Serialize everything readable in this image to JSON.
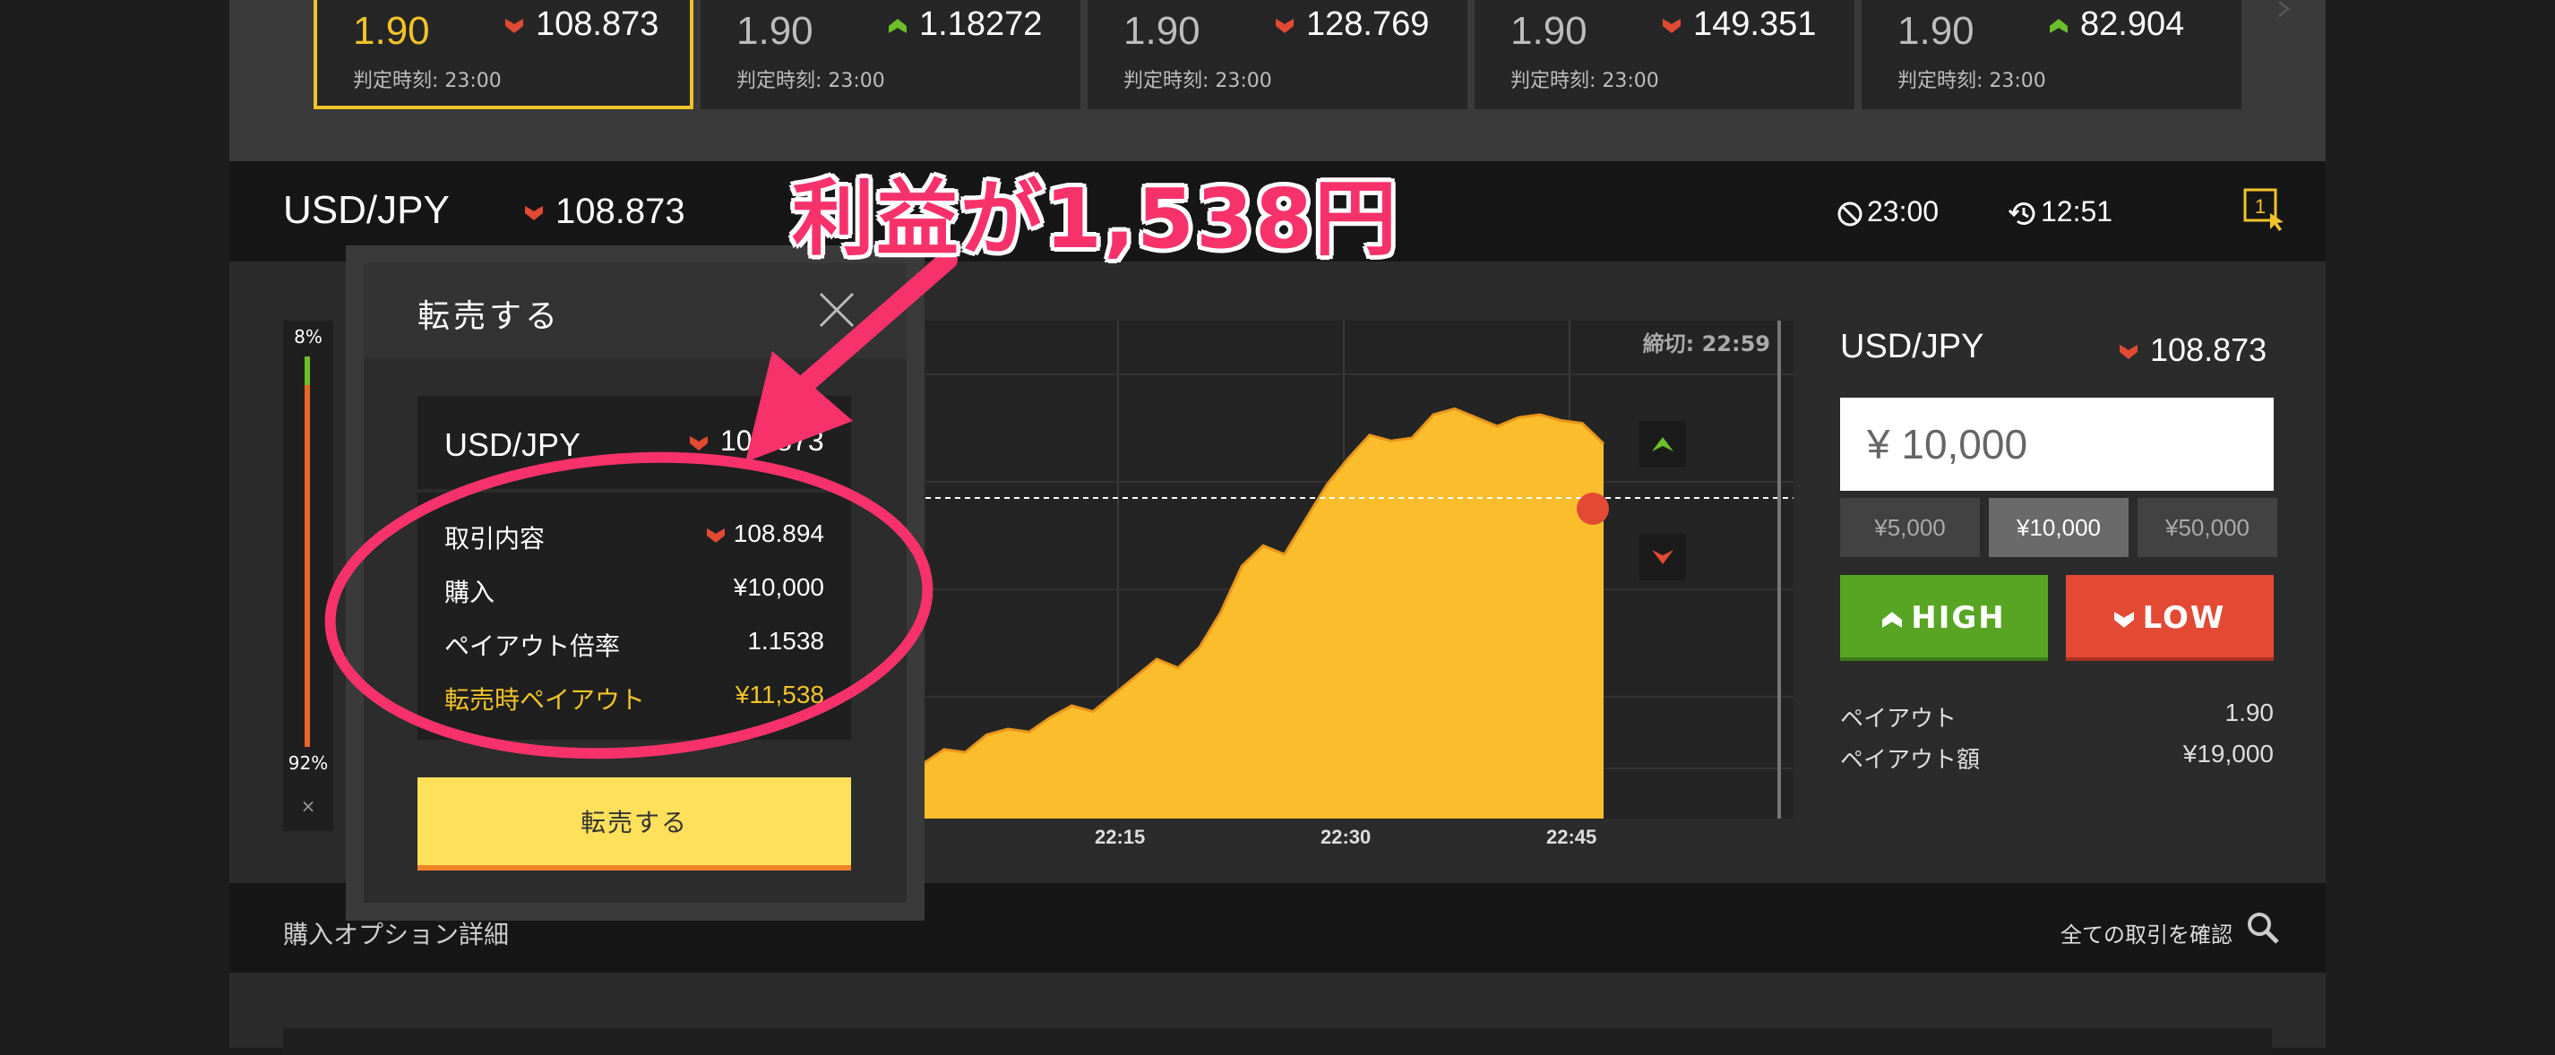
{
  "assets": [
    {
      "payout": "1.90",
      "rate": "108.873",
      "direction": "down",
      "judge": "判定時刻: 23:00",
      "active": true
    },
    {
      "payout": "1.90",
      "rate": "1.18272",
      "direction": "up",
      "judge": "判定時刻: 23:00",
      "active": false
    },
    {
      "payout": "1.90",
      "rate": "128.769",
      "direction": "down",
      "judge": "判定時刻: 23:00",
      "active": false
    },
    {
      "payout": "1.90",
      "rate": "149.351",
      "direction": "down",
      "judge": "判定時刻: 23:00",
      "active": false
    },
    {
      "payout": "1.90",
      "rate": "82.904",
      "direction": "up",
      "judge": "判定時刻: 23:00",
      "active": false
    }
  ],
  "header": {
    "pair": "USD/JPY",
    "rate": "108.873",
    "expiry": "23:00",
    "remaining": "12:51",
    "one_click_label": "1"
  },
  "sentiment": {
    "high": "8%",
    "low": "92%",
    "close": "×"
  },
  "chart": {
    "deadline": "締切: 22:59",
    "xticks": [
      "22:15",
      "22:30",
      "22:45"
    ],
    "series": [
      98.0,
      98.5,
      98.4,
      99.0,
      99.2,
      99.1,
      99.6,
      100.0,
      99.8,
      100.4,
      101.0,
      101.6,
      101.3,
      102.0,
      103.2,
      104.8,
      105.5,
      105.2,
      106.4,
      107.6,
      108.5,
      109.3,
      109.1,
      109.2,
      110.0,
      110.2,
      109.9,
      109.6,
      109.9,
      110.0,
      109.8,
      109.7,
      109.0
    ]
  },
  "trade_panel": {
    "pair": "USD/JPY",
    "rate": "108.873",
    "amount_value": "¥ 10,000",
    "presets": [
      "¥5,000",
      "¥10,000",
      "¥50,000"
    ],
    "selected_preset": 1,
    "high_label": "HIGH",
    "low_label": "LOW",
    "payout_label": "ペイアウト",
    "payout_value": "1.90",
    "payout_amount_label": "ペイアウト額",
    "payout_amount_value": "¥19,000"
  },
  "detail_bar": {
    "title": "購入オプション詳細",
    "all_trades": "全ての取引を確認"
  },
  "modal": {
    "title": "転売する",
    "pair": "USD/JPY",
    "rate": "108.873",
    "rows": [
      {
        "label": "取引内容",
        "value": "108.894",
        "icon": true
      },
      {
        "label": "購入",
        "value": "¥10,000"
      },
      {
        "label": "ペイアウト倍率",
        "value": "1.1538"
      },
      {
        "label": "転売時ペイアウト",
        "value": "¥11,538",
        "highlight": true
      }
    ],
    "button_label": "転売する"
  },
  "annotation": {
    "text": "利益が1,538円"
  },
  "colors": {
    "accent": "#f2c32a",
    "high": "#58a524",
    "low": "#e24a34",
    "annotation": "#f7326a"
  }
}
